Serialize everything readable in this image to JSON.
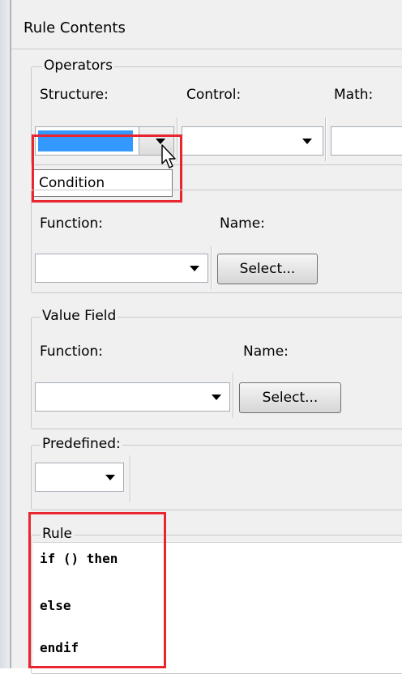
{
  "window": {
    "title": "Rule Contents"
  },
  "operators": {
    "legend": "Operators",
    "structure_label": "Structure:",
    "control_label": "Control:",
    "math_label": "Math:",
    "structure_dropdown_option": "Condition"
  },
  "function_group": {
    "function_label": "Function:",
    "name_label": "Name:",
    "select_label": "Select..."
  },
  "value_field": {
    "legend": "Value Field",
    "function_label": "Function:",
    "name_label": "Name:",
    "select_label": "Select..."
  },
  "predefined": {
    "legend": "Predefined:"
  },
  "rule": {
    "legend": "Rule",
    "lines": [
      "if () then",
      "else",
      "endif"
    ]
  },
  "colors": {
    "selection": "#3399ff",
    "highlight_box": "#e8262f"
  },
  "icons": [
    "dropdown-arrow-icon",
    "mouse-pointer-icon"
  ]
}
